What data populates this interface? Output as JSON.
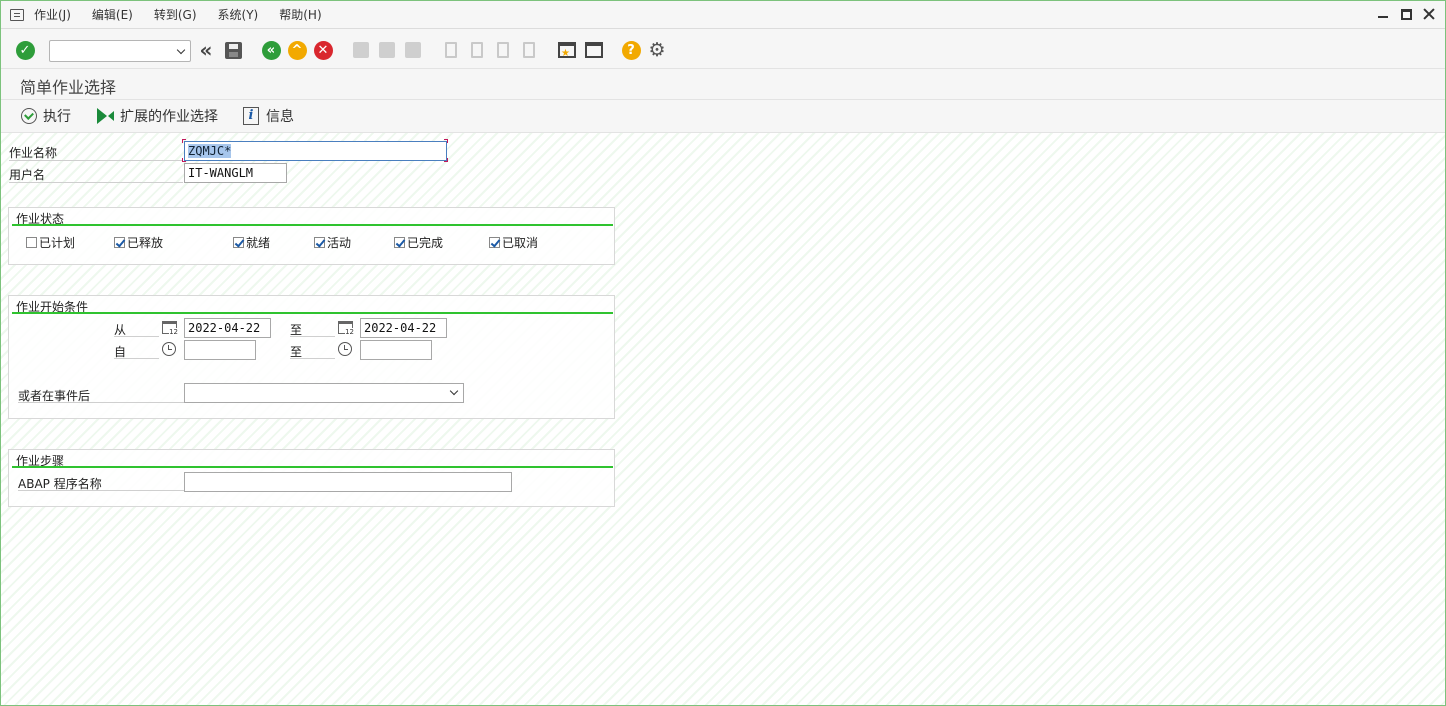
{
  "menu": {
    "items": [
      "作业(J)",
      "编辑(E)",
      "转到(G)",
      "系统(Y)",
      "帮助(H)"
    ]
  },
  "toolbar": {
    "command_value": ""
  },
  "title": "简单作业选择",
  "app_toolbar": {
    "execute": "执行",
    "extended": "扩展的作业选择",
    "info": "信息"
  },
  "job_name": {
    "label": "作业名称",
    "value": "ZQMJC*"
  },
  "user_name": {
    "label": "用户名",
    "value": "IT-WANGLM"
  },
  "job_status": {
    "title": "作业状态",
    "items": [
      {
        "label": "已计划",
        "checked": false
      },
      {
        "label": "已释放",
        "checked": true
      },
      {
        "label": "就绪",
        "checked": true
      },
      {
        "label": "活动",
        "checked": true
      },
      {
        "label": "已完成",
        "checked": true
      },
      {
        "label": "已取消",
        "checked": true
      }
    ]
  },
  "start_conditions": {
    "title": "作业开始条件",
    "from_label": "从",
    "to_label": "至",
    "from_date": "2022-04-22",
    "to_date": "2022-04-22",
    "time_from_label": "自",
    "time_to_label": "至",
    "time_from": "",
    "time_to": "",
    "event_label": "或者在事件后",
    "event_value": ""
  },
  "job_steps": {
    "title": "作业步骤",
    "abap_label": "ABAP 程序名称",
    "abap_value": ""
  }
}
